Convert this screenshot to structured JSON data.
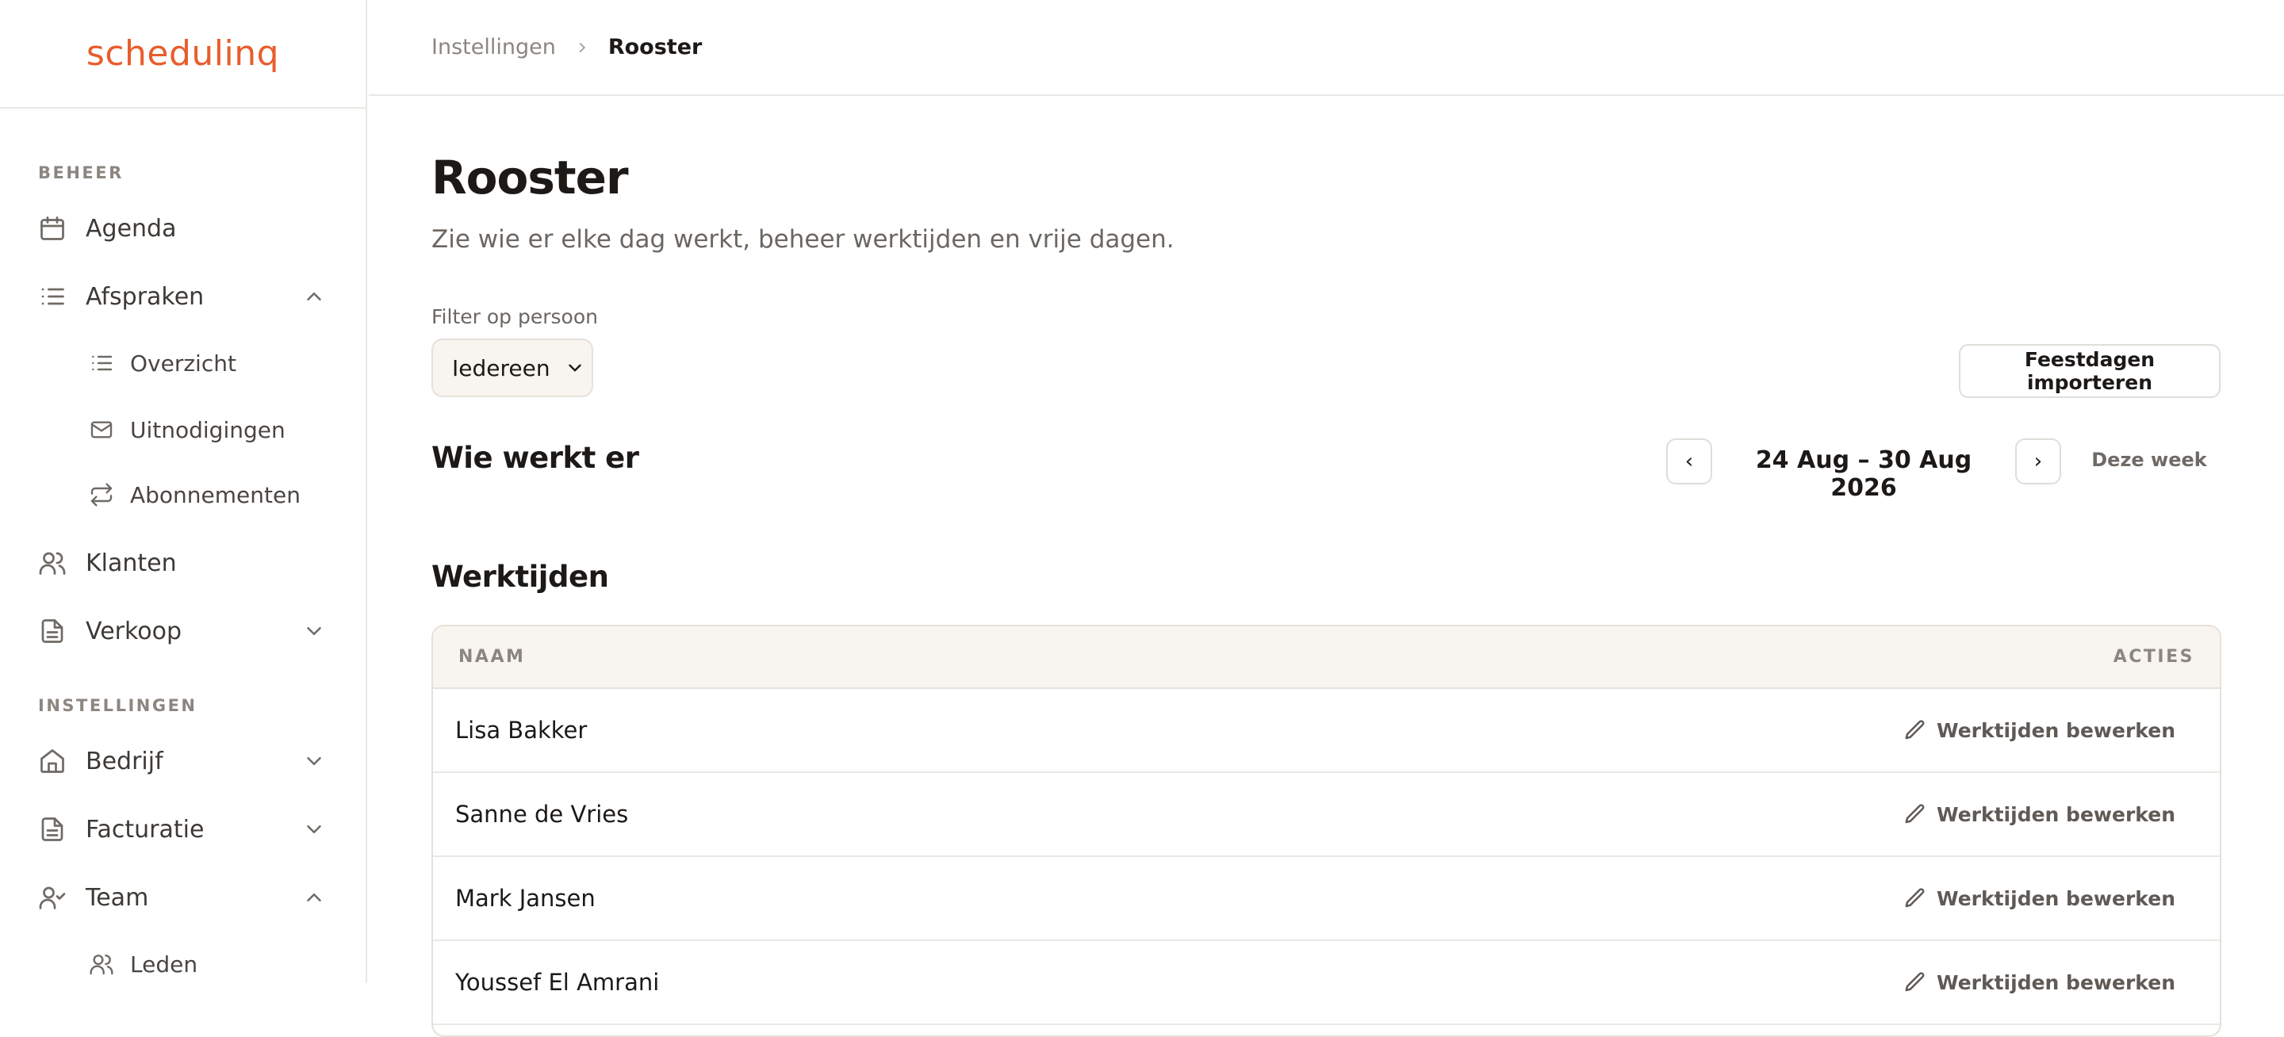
{
  "brand": {
    "name": "schedulinq",
    "color": "#e85d2c"
  },
  "sidebar": {
    "sections": [
      {
        "label": "BEHEER"
      },
      {
        "label": "INSTELLINGEN"
      }
    ],
    "items": [
      {
        "label": "Agenda",
        "icon": "calendar-icon"
      },
      {
        "label": "Afspraken",
        "icon": "list-icon",
        "expanded": true
      },
      {
        "label": "Overzicht",
        "icon": "list-icon"
      },
      {
        "label": "Uitnodigingen",
        "icon": "mail-icon"
      },
      {
        "label": "Abonnementen",
        "icon": "repeat-icon"
      },
      {
        "label": "Klanten",
        "icon": "users-icon"
      },
      {
        "label": "Verkoop",
        "icon": "file-icon",
        "expanded": false
      },
      {
        "label": "Bedrijf",
        "icon": "home-icon",
        "expanded": false
      },
      {
        "label": "Facturatie",
        "icon": "file-icon",
        "expanded": false
      },
      {
        "label": "Team",
        "icon": "user-check-icon",
        "expanded": true
      },
      {
        "label": "Leden",
        "icon": "users-icon"
      }
    ]
  },
  "breadcrumb": {
    "parent": "Instellingen",
    "current": "Rooster"
  },
  "page": {
    "title": "Rooster",
    "subtitle": "Zie wie er elke dag werkt, beheer werktijden en vrije dagen."
  },
  "filter": {
    "label": "Filter op persoon",
    "selected": "Iedereen"
  },
  "import_button": "Feestdagen importeren",
  "who_works": {
    "title": "Wie werkt er",
    "prev": "‹",
    "next": "›",
    "range": "24 Aug – 30 Aug 2026",
    "this_week": "Deze week"
  },
  "worktimes": {
    "title": "Werktijden",
    "columns": {
      "name": "NAAM",
      "actions": "ACTIES"
    },
    "rows": [
      {
        "name": "Lisa Bakker",
        "action": "Werktijden bewerken"
      },
      {
        "name": "Sanne de Vries",
        "action": "Werktijden bewerken"
      },
      {
        "name": "Mark Jansen",
        "action": "Werktijden bewerken"
      },
      {
        "name": "Youssef El Amrani",
        "action": "Werktijden bewerken"
      }
    ]
  }
}
